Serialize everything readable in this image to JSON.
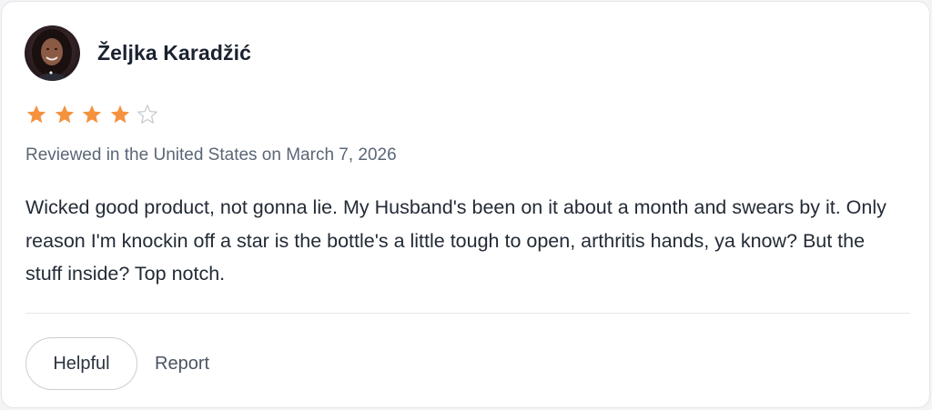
{
  "review": {
    "reviewer_name": "Željka Karadžić",
    "avatar_icon": "reviewer-photo",
    "rating": 4,
    "max_rating": 5,
    "star_color": "#f5923e",
    "empty_star_color": "#c9ccd1",
    "meta": "Reviewed in the United States on March 7, 2026",
    "text": "Wicked good product, not gonna lie. My Husband's been on it about a month and swears by it. Only reason I'm knockin off a star is the bottle's a little tough to open, arthritis hands, ya know? But the stuff inside? Top notch."
  },
  "actions": {
    "helpful_label": "Helpful",
    "report_label": "Report"
  }
}
